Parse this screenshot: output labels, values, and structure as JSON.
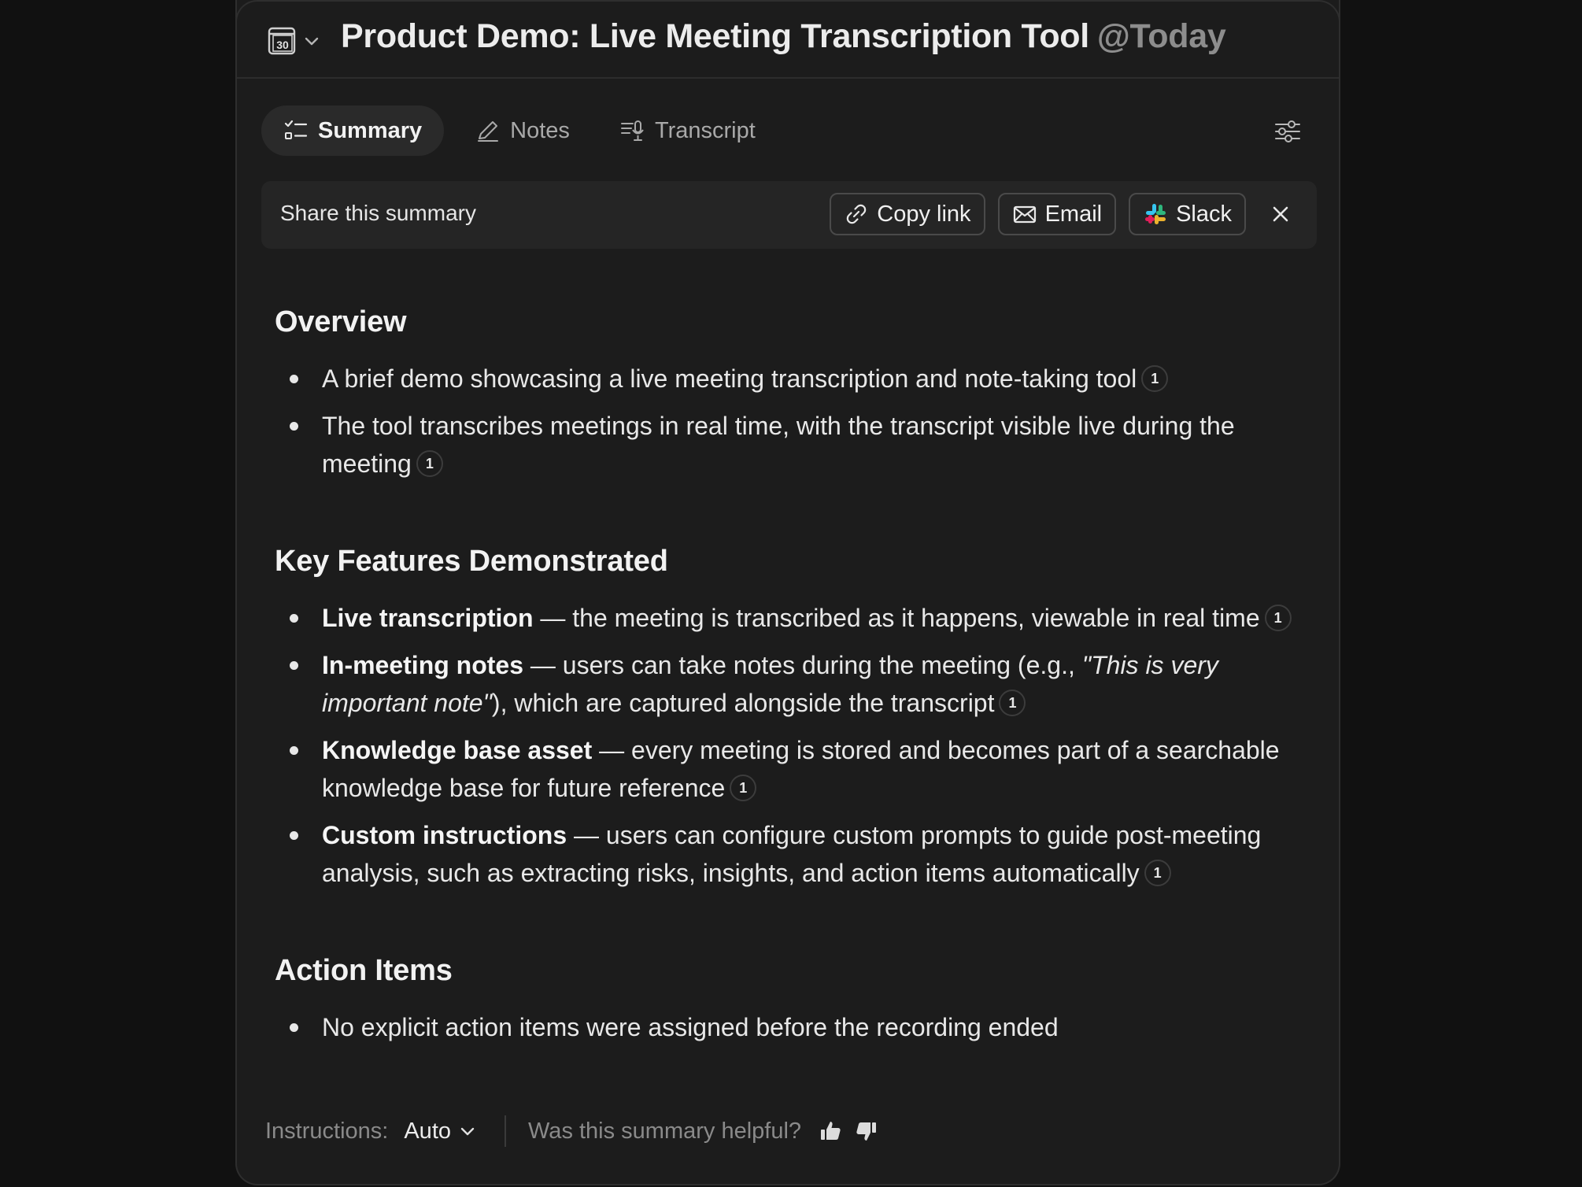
{
  "header": {
    "calendar_day": "30",
    "title": "Product Demo: Live Meeting Transcription Tool",
    "date_tag": "@Today"
  },
  "tabs": [
    {
      "label": "Summary",
      "active": true
    },
    {
      "label": "Notes",
      "active": false
    },
    {
      "label": "Transcript",
      "active": false
    }
  ],
  "share": {
    "label": "Share this summary",
    "copy_link": "Copy link",
    "email": "Email",
    "slack": "Slack"
  },
  "sections": {
    "overview": {
      "heading": "Overview",
      "items": [
        {
          "text": "A brief demo showcasing a live meeting transcription and note-taking tool",
          "cite": "1"
        },
        {
          "text": "The tool transcribes meetings in real time, with the transcript visible live during the meeting",
          "cite": "1"
        }
      ]
    },
    "features": {
      "heading": "Key Features Demonstrated",
      "items": [
        {
          "bold": "Live transcription",
          "text": " — the meeting is transcribed as it happens, viewable in real time",
          "cite": "1"
        },
        {
          "bold": "In-meeting notes",
          "text": " — users can take notes during the meeting (e.g., ",
          "italic": "\"This is very important note\"",
          "text2": "), which are captured alongside the transcript",
          "cite": "1"
        },
        {
          "bold": "Knowledge base asset",
          "text": " — every meeting is stored and becomes part of a searchable knowledge base for future reference",
          "cite": "1"
        },
        {
          "bold": "Custom instructions",
          "text": " — users can configure custom prompts to guide post-meeting analysis, such as extracting risks, insights, and action items automatically",
          "cite": "1"
        }
      ]
    },
    "actions": {
      "heading": "Action Items",
      "items": [
        {
          "text": "No explicit action items were assigned before the recording ended"
        }
      ]
    }
  },
  "footer": {
    "instructions_label": "Instructions:",
    "instructions_value": "Auto",
    "feedback_prompt": "Was this summary helpful?"
  },
  "icons": [
    "calendar-icon",
    "chevron-down-icon",
    "checklist-icon",
    "pen-icon",
    "transcript-mic-icon",
    "sliders-icon",
    "link-icon",
    "mail-icon",
    "slack-icon",
    "close-icon",
    "thumbs-up-icon",
    "thumbs-down-icon"
  ],
  "colors": {
    "background": "#111111",
    "panel": "#1c1c1c",
    "share_bar": "#252525",
    "muted_text": "#8d8d8d"
  }
}
